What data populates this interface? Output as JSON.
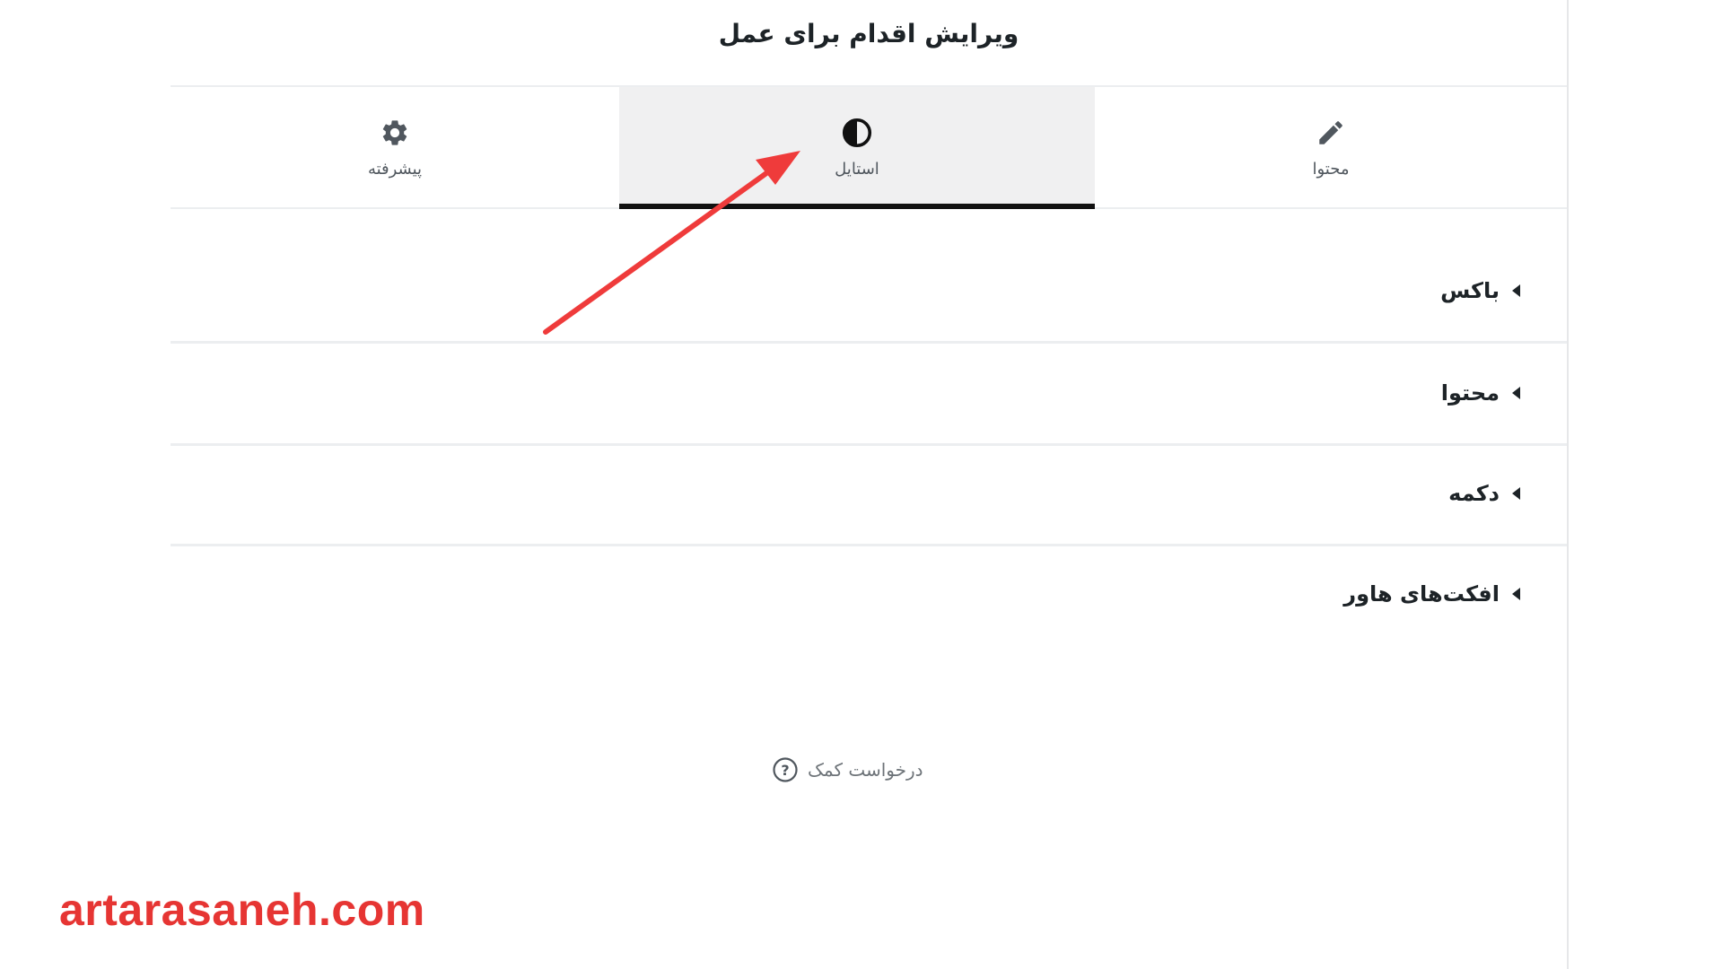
{
  "header": {
    "title": "ویرایش اقدام برای عمل"
  },
  "tabs": [
    {
      "label": "پیشرفته",
      "icon": "gear-icon"
    },
    {
      "label": "استایل",
      "icon": "half-circle-contrast-icon",
      "active": true
    },
    {
      "label": "محتوا",
      "icon": "pencil-icon"
    }
  ],
  "sections": [
    {
      "title": "باکس"
    },
    {
      "title": "محتوا"
    },
    {
      "title": "دکمه"
    },
    {
      "title": "افکت‌های هاور"
    }
  ],
  "help": {
    "label": "درخواست کمک",
    "icon": "question-circle-icon"
  },
  "annotation": {
    "color": "#ef3b3b"
  },
  "watermark": {
    "text": "artarasaneh.com",
    "color": "#e63533"
  },
  "colors": {
    "active_tab_bg": "#f0f0f1",
    "active_indicator": "#111111",
    "text_primary": "#1d2327",
    "text_secondary": "#50575e"
  }
}
